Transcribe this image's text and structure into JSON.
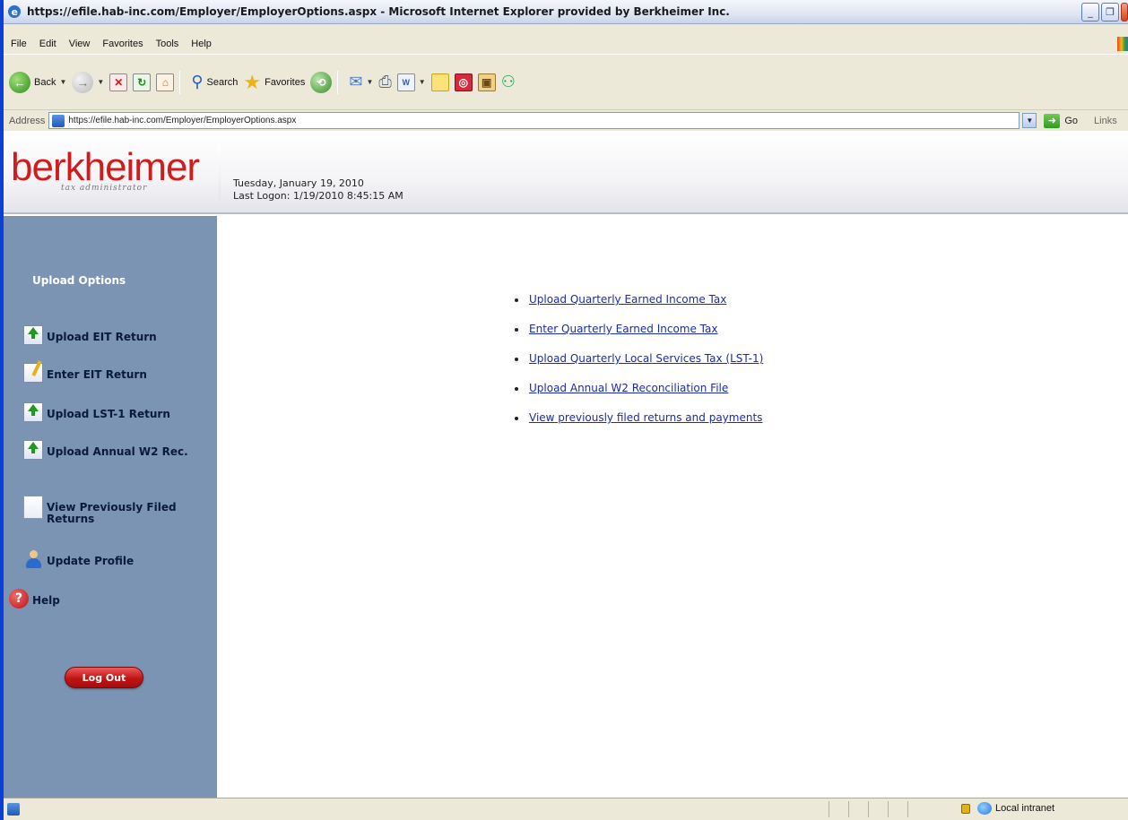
{
  "window": {
    "title": "https://efile.hab-inc.com/Employer/EmployerOptions.aspx - Microsoft Internet Explorer provided by Berkheimer Inc."
  },
  "menu": [
    "File",
    "Edit",
    "View",
    "Favorites",
    "Tools",
    "Help"
  ],
  "toolbar": {
    "back_label": "Back",
    "search_label": "Search",
    "favorites_label": "Favorites"
  },
  "address": {
    "label": "Address",
    "url": "https://efile.hab-inc.com/Employer/EmployerOptions.aspx",
    "go_label": "Go",
    "links_label": "Links"
  },
  "header": {
    "logo_word": "berkheimer",
    "logo_sub": "tax administrator",
    "date": "Tuesday, January 19, 2010",
    "last_logon": "Last Logon: 1/19/2010 8:45:15 AM"
  },
  "sidebar": {
    "title": "Upload Options",
    "items": [
      {
        "label": "Upload EIT Return",
        "icon": "upload-document-icon"
      },
      {
        "label": "Enter EIT Return",
        "icon": "edit-document-icon"
      },
      {
        "label": "Upload LST-1 Return",
        "icon": "upload-document-icon"
      },
      {
        "label": "Upload Annual W2 Rec.",
        "icon": "upload-document-icon"
      },
      {
        "label": "View Previously Filed Returns",
        "icon": "document-icon"
      },
      {
        "label": "Update Profile",
        "icon": "user-icon"
      },
      {
        "label": "Help",
        "icon": "help-icon"
      }
    ],
    "logout_label": "Log Out"
  },
  "main": {
    "links": [
      "Upload Quarterly Earned Income Tax",
      "Enter Quarterly Earned Income Tax",
      "Upload Quarterly Local Services Tax (LST-1)",
      "Upload Annual W2 Reconciliation File",
      "View previously filed returns and payments"
    ]
  },
  "status": {
    "zone_label": "Local intranet"
  },
  "colors": {
    "sidebar_bg": "#7b94b3",
    "link": "#1a2ca8",
    "brand_red": "#cf1d1d"
  }
}
